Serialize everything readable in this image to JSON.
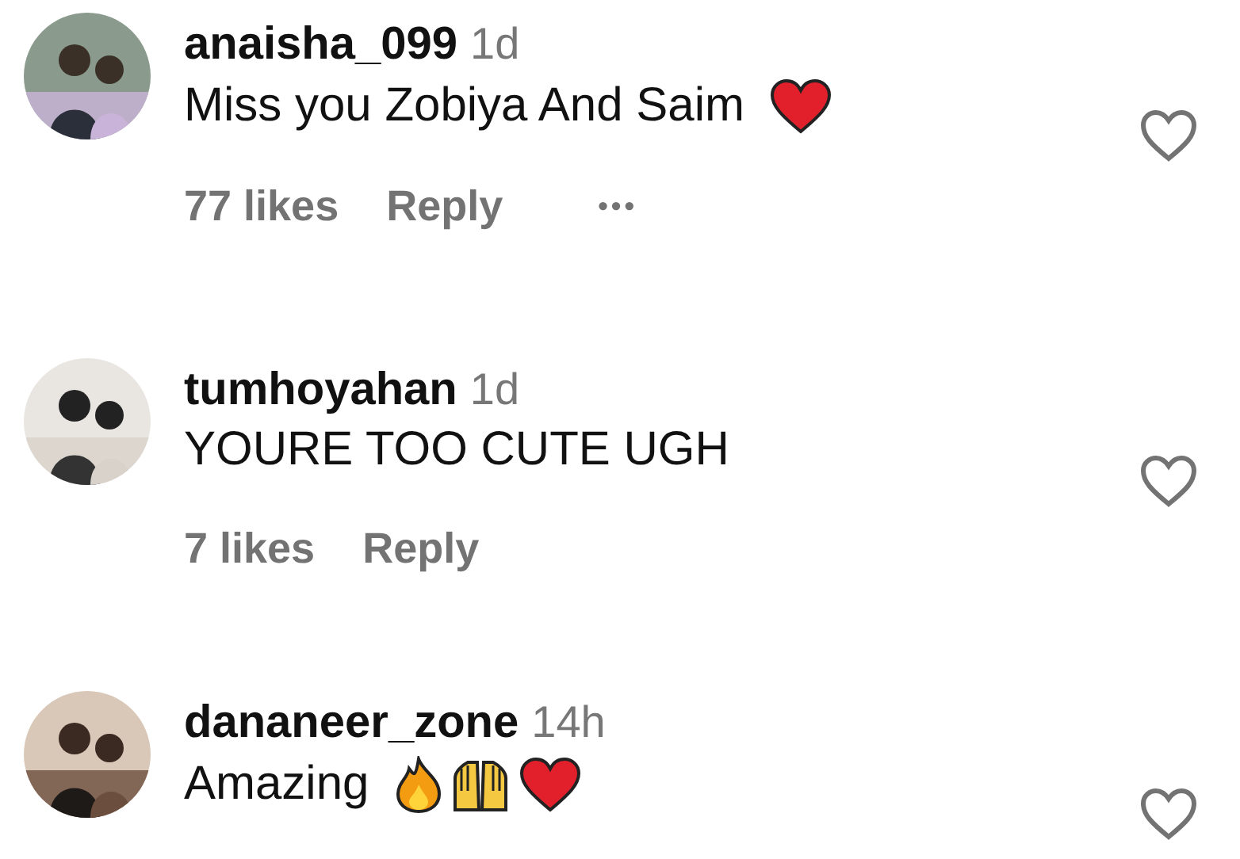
{
  "comments": [
    {
      "username": "anaisha_099",
      "time": "1d",
      "text": "Miss you Zobiya And Saim",
      "emojis": [
        {
          "kind": "heart"
        }
      ],
      "likes": "77 likes",
      "reply": "Reply",
      "more": "•••",
      "liked": false
    },
    {
      "username": "tumhoyahan",
      "time": "1d",
      "text": "YOURE TOO CUTE UGH",
      "likes": "7 likes",
      "reply": "Reply",
      "liked": false
    },
    {
      "username": "dananeer_zone",
      "time": "14h",
      "text": "Amazing",
      "emojis": [
        {
          "kind": "fire"
        },
        {
          "kind": "raised-hands"
        },
        {
          "kind": "heart"
        }
      ],
      "liked": false
    }
  ]
}
